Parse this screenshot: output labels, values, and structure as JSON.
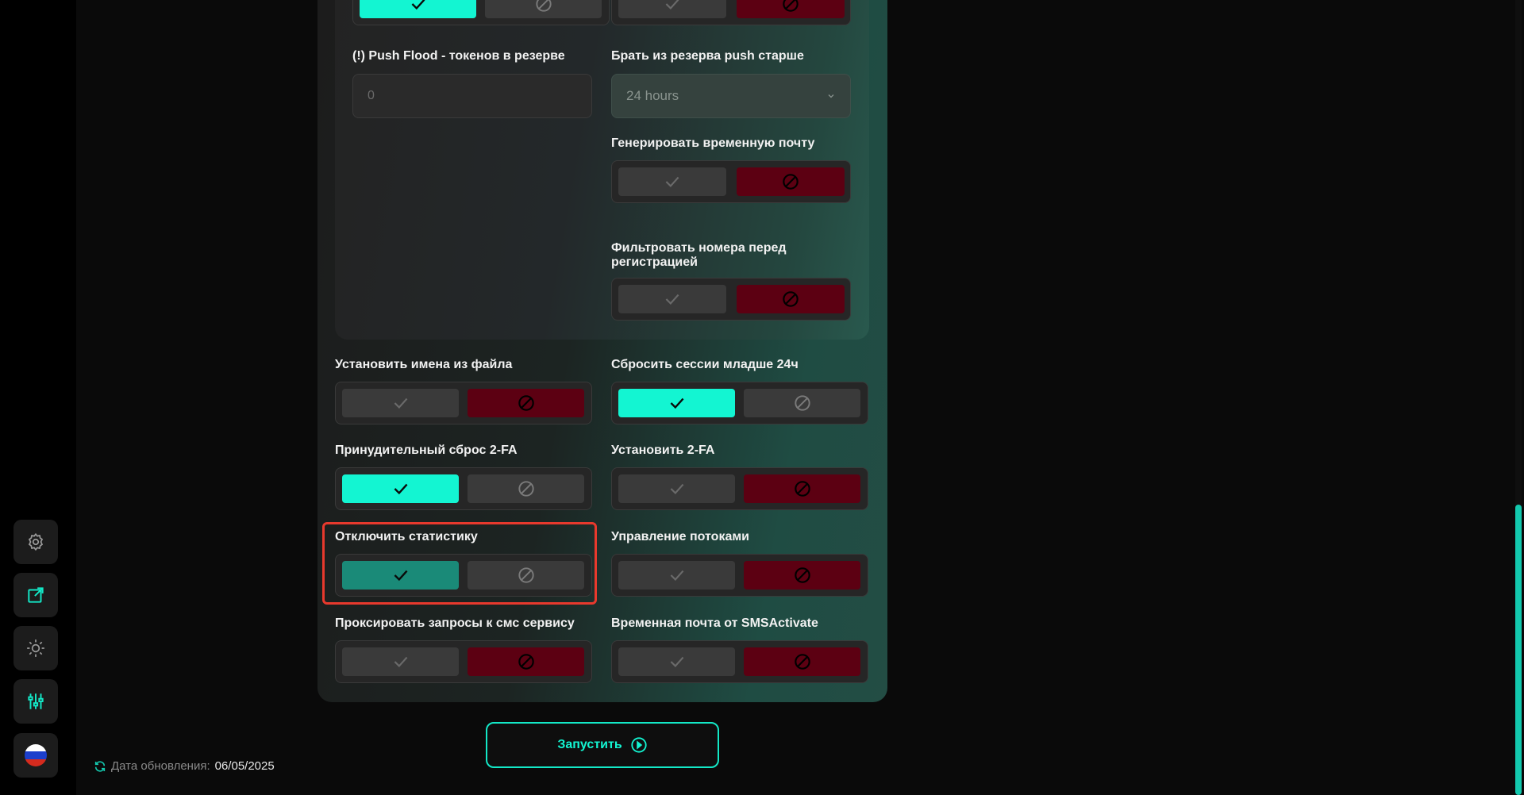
{
  "sidebar": {
    "items": [
      {
        "icon": "gear-icon"
      },
      {
        "icon": "export-icon"
      },
      {
        "icon": "brightness-icon"
      },
      {
        "icon": "sliders-icon"
      },
      {
        "icon": "russia-flag-icon"
      }
    ]
  },
  "footer": {
    "update_label": "Дата обновления:",
    "update_value": "06/05/2025"
  },
  "settings": {
    "push_flood_label": "(!) Push Flood - токенов в резерве",
    "push_flood_placeholder": "0",
    "reserve_label": "Брать из резерва push старше",
    "reserve_value": "24 hours",
    "temp_mail_label": "Генерировать временную почту",
    "filter_numbers_label": "Фильтровать номера перед регистрацией",
    "names_from_file_label": "Установить имена из файла",
    "reset_sessions_label": "Сбросить сессии младше 24ч",
    "force_reset_2fa_label": "Принудительный сброс 2-FA",
    "set_2fa_label": "Установить 2-FA",
    "disable_stats_label": "Отключить статистику",
    "threads_control_label": "Управление потоками",
    "proxy_sms_label": "Проксировать запросы к смс сервису",
    "temp_mail_sms_label": "Временная почта от SMSActivate"
  },
  "run_button": {
    "label": "Запустить"
  },
  "colors": {
    "accent": "#13f5d2",
    "off_red": "#5c0012",
    "highlight": "#e8392d"
  }
}
